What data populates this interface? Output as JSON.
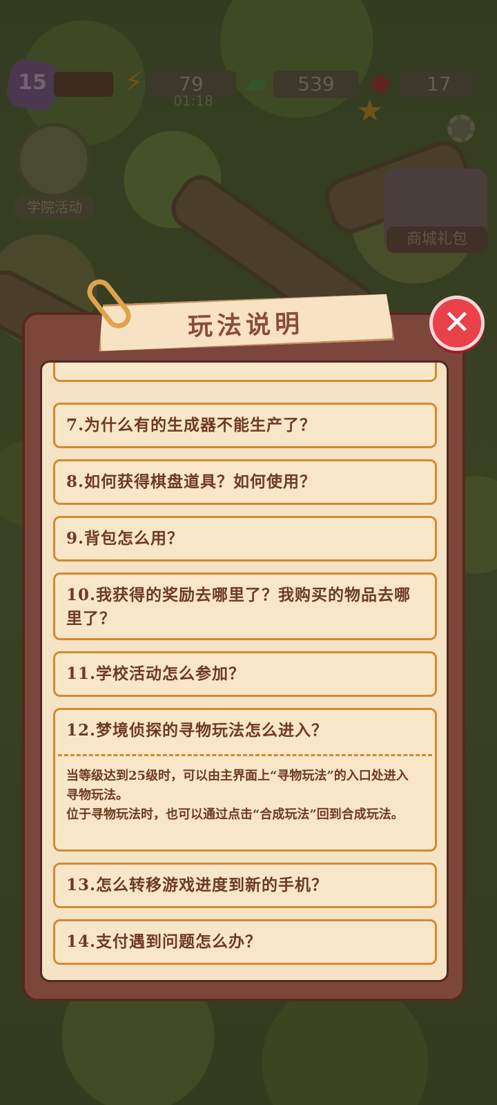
{
  "hud": {
    "level": "15",
    "energy": "79",
    "energy_timer": "01:18",
    "cash": "539",
    "gems": "17",
    "energy_icon": "lightning-icon",
    "cash_icon": "cash-icon",
    "gem_icon": "ruby-icon"
  },
  "side_buttons": {
    "left_event_label": "学院活动",
    "right_gift_label": "商城礼包"
  },
  "modal": {
    "title": "玩法说明",
    "close_label": "✕",
    "items": [
      {
        "question": "7.为什么有的生成器不能生产了？"
      },
      {
        "question": "8.如何获得棋盘道具？如何使用？"
      },
      {
        "question": "9.背包怎么用？"
      },
      {
        "question": "10.我获得的奖励去哪里了？我购买的物品去哪里了？"
      },
      {
        "question": "11.学校活动怎么参加？"
      },
      {
        "question": "12.梦境侦探的寻物玩法怎么进入？",
        "answer": "当等级达到25级时，可以由主界面上“寻物玩法”的入口处进入寻物玩法。\n位于寻物玩法时，也可以通过点击“合成玩法”回到合成玩法。"
      },
      {
        "question": "13.怎么转移游戏进度到新的手机？"
      },
      {
        "question": "14.支付遇到问题怎么办？"
      }
    ]
  },
  "colors": {
    "panel": "#7c463a",
    "paper": "#f6e3c6",
    "item_border": "#d18a2e",
    "text": "#6e3a22",
    "close": "#e8414a"
  }
}
